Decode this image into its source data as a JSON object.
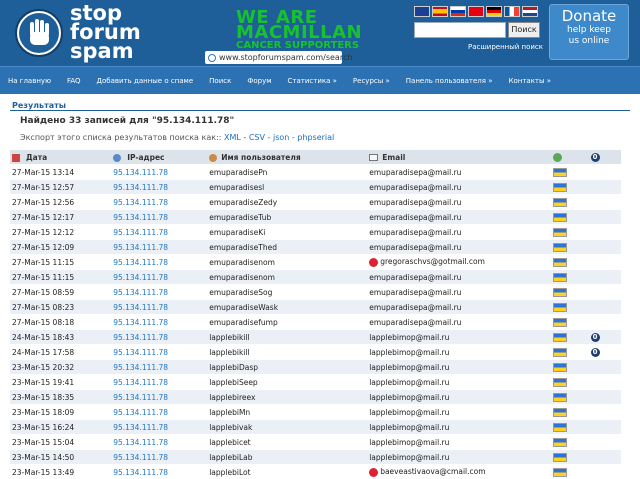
{
  "site": {
    "logo_line1": "stop",
    "logo_line2": "forum",
    "logo_line3": "spam",
    "campaign_line1": "WE ARE",
    "campaign_line2": "MACMILLAN",
    "campaign_line3": "CANCER SUPPORTERS",
    "url": "www.stopforumspam.com/search",
    "search_button": "Поиск",
    "advanced_search": "Расширенный поиск",
    "donate_title": "Donate",
    "donate_sub1": "help keep",
    "donate_sub2": "us online",
    "flag_colors": [
      "#1c3f94",
      "#d52b1e",
      "#ffffff",
      "#e60012",
      "#000000",
      "#0055a4",
      "#ae1c28"
    ]
  },
  "nav": [
    "На главную",
    "FAQ",
    "Добавить данные о спаме",
    "Поиск",
    "Форум",
    "Статистика »",
    "Ресурсы »",
    "Панель пользователя »",
    "Контакты »"
  ],
  "results": {
    "title": "Результаты",
    "found": "Найдено 33 записей для \"95.134.111.78\"",
    "export_prefix": "Экспорт этого списка результатов поиска как:: ",
    "export_xml": "XML",
    "export_csv": "CSV",
    "export_json": "json",
    "export_php": "phpserial",
    "sep": " - "
  },
  "table": {
    "headers": [
      "Дата",
      "IP-адрес",
      "Имя пользователя",
      "Email"
    ],
    "rows": [
      {
        "date": "27-Mar-15 13:14",
        "ip": "95.134.111.78",
        "user": "emuparadisePn",
        "email": "emuparadisepa@mail.ru",
        "hazard": false,
        "tor": false
      },
      {
        "date": "27-Mar-15 12:57",
        "ip": "95.134.111.78",
        "user": "emuparadisesl",
        "email": "emuparadisepa@mail.ru",
        "hazard": false,
        "tor": false
      },
      {
        "date": "27-Mar-15 12:56",
        "ip": "95.134.111.78",
        "user": "emuparadiseZedy",
        "email": "emuparadisepa@mail.ru",
        "hazard": false,
        "tor": false
      },
      {
        "date": "27-Mar-15 12:17",
        "ip": "95.134.111.78",
        "user": "emuparadiseTub",
        "email": "emuparadisepa@mail.ru",
        "hazard": false,
        "tor": false
      },
      {
        "date": "27-Mar-15 12:12",
        "ip": "95.134.111.78",
        "user": "emuparadiseKi",
        "email": "emuparadisepa@mail.ru",
        "hazard": false,
        "tor": false
      },
      {
        "date": "27-Mar-15 12:09",
        "ip": "95.134.111.78",
        "user": "emuparadiseThed",
        "email": "emuparadisepa@mail.ru",
        "hazard": false,
        "tor": false
      },
      {
        "date": "27-Mar-15 11:15",
        "ip": "95.134.111.78",
        "user": "emuparadisenom",
        "email": "gregoraschvs@gotmail.com",
        "hazard": true,
        "tor": false
      },
      {
        "date": "27-Mar-15 11:15",
        "ip": "95.134.111.78",
        "user": "emuparadisenom",
        "email": "emuparadisepa@mail.ru",
        "hazard": false,
        "tor": false
      },
      {
        "date": "27-Mar-15 08:59",
        "ip": "95.134.111.78",
        "user": "emuparadiseSog",
        "email": "emuparadisepa@mail.ru",
        "hazard": false,
        "tor": false
      },
      {
        "date": "27-Mar-15 08:23",
        "ip": "95.134.111.78",
        "user": "emuparadiseWask",
        "email": "emuparadisepa@mail.ru",
        "hazard": false,
        "tor": false
      },
      {
        "date": "27-Mar-15 08:18",
        "ip": "95.134.111.78",
        "user": "emuparadisefump",
        "email": "emuparadisepa@mail.ru",
        "hazard": false,
        "tor": false
      },
      {
        "date": "24-Mar-15 18:43",
        "ip": "95.134.111.78",
        "user": "lapplebikill",
        "email": "lapplebimop@mail.ru",
        "hazard": false,
        "tor": true
      },
      {
        "date": "24-Mar-15 17:58",
        "ip": "95.134.111.78",
        "user": "lapplebikill",
        "email": "lapplebimop@mail.ru",
        "hazard": false,
        "tor": true
      },
      {
        "date": "23-Mar-15 20:32",
        "ip": "95.134.111.78",
        "user": "lapplebiDasp",
        "email": "lapplebimop@mail.ru",
        "hazard": false,
        "tor": false
      },
      {
        "date": "23-Mar-15 19:41",
        "ip": "95.134.111.78",
        "user": "lapplebiSeep",
        "email": "lapplebimop@mail.ru",
        "hazard": false,
        "tor": false
      },
      {
        "date": "23-Mar-15 18:35",
        "ip": "95.134.111.78",
        "user": "lapplebireex",
        "email": "lapplebimop@mail.ru",
        "hazard": false,
        "tor": false
      },
      {
        "date": "23-Mar-15 18:09",
        "ip": "95.134.111.78",
        "user": "lapplebiMn",
        "email": "lapplebimop@mail.ru",
        "hazard": false,
        "tor": false
      },
      {
        "date": "23-Mar-15 16:24",
        "ip": "95.134.111.78",
        "user": "lapplebivak",
        "email": "lapplebimop@mail.ru",
        "hazard": false,
        "tor": false
      },
      {
        "date": "23-Mar-15 15:04",
        "ip": "95.134.111.78",
        "user": "lapplebicet",
        "email": "lapplebimop@mail.ru",
        "hazard": false,
        "tor": false
      },
      {
        "date": "23-Mar-15 14:50",
        "ip": "95.134.111.78",
        "user": "lapplebiLab",
        "email": "lapplebimop@mail.ru",
        "hazard": false,
        "tor": false
      },
      {
        "date": "23-Mar-15 13:49",
        "ip": "95.134.111.78",
        "user": "lapplebiLot",
        "email": "baeveastivaova@cmail.com",
        "hazard": true,
        "tor": false
      }
    ]
  }
}
